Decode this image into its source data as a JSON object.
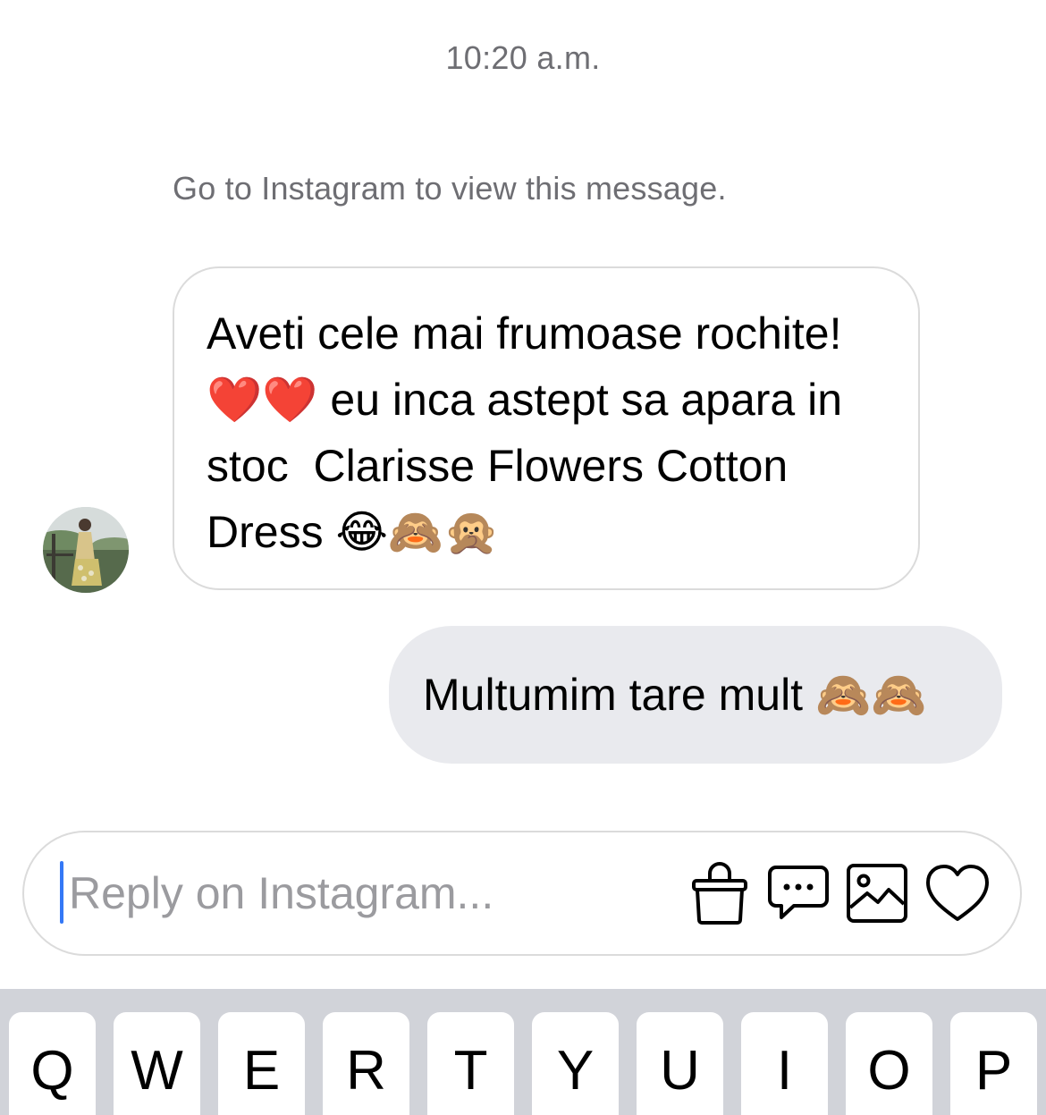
{
  "timestamp": "10:20 a.m.",
  "system_note": "Go to Instagram to view this message.",
  "messages": [
    {
      "direction": "incoming",
      "text": "Aveti cele mai frumoase rochite! ❤️❤️ eu inca astept sa apara in stoc  Clarisse Flowers Cotton Dress 😂🙈🙊"
    },
    {
      "direction": "outgoing",
      "text": "Multumim tare mult 🙈🙈"
    }
  ],
  "composer": {
    "placeholder": "Reply on Instagram...",
    "value": "",
    "icons": [
      "shopping-bag-icon",
      "chat-bubble-icon",
      "image-icon",
      "heart-icon"
    ]
  },
  "keyboard": {
    "row1": [
      "Q",
      "W",
      "E",
      "R",
      "T",
      "Y",
      "U",
      "I",
      "O",
      "P"
    ]
  },
  "colors": {
    "outgoing_bubble": "#e9eaee",
    "incoming_border": "#dbdbdb",
    "caret": "#3478f6",
    "keyboard_bg": "#d1d3d9",
    "muted_text": "#6e6e73"
  }
}
